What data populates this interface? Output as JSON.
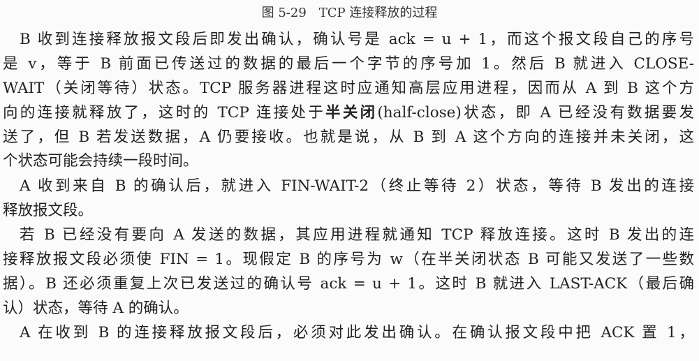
{
  "figure_caption": "图 5-29　TCP 连接释放的过程",
  "lines": [
    "B 收到连接释放报文段后即发出确认，确认号是 ack = u + 1，而这个报文段自己的序号",
    "是 v，等于 B 前面已传送过的数据的最后一个字节的序号加 1。然后 B 就进入 CLOSE-",
    "WAIT（关闭等待）状态。TCP 服务器进程这时应通知高层应用进程，因而从 A 到 B 这个方",
    {
      "before": "向的连接就释放了，这时的 TCP 连接处于",
      "bold": "半关闭",
      "after": "(half-close)状态，即 A 已经没有数据要发"
    },
    "送了，但 B 若发送数据，A 仍要接收。也就是说，从 B 到 A 这个方向的连接并未关闭，这",
    "个状态可能会持续一段时间。",
    "A 收到来自 B 的确认后，就进入 FIN-WAIT-2（终止等待 2）状态，等待 B 发出的连接",
    "释放报文段。",
    "若 B 已经没有要向 A 发送的数据，其应用进程就通知 TCP 释放连接。这时 B 发出的连",
    "接释放报文段必须使 FIN = 1。现假定 B 的序号为 w（在半关闭状态 B 可能又发送了一些数",
    "据）。B 还必须重复上次已发送过的确认号 ack = u + 1。这时 B 就进入 LAST-ACK（最后确",
    "认）状态，等待 A 的确认。",
    "A 在收到 B 的连接释放报文段后，必须对此发出确认。在确认报文段中把 ACK 置 1，"
  ]
}
